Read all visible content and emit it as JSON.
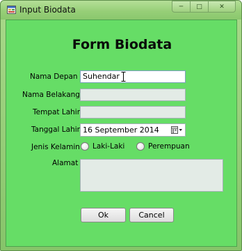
{
  "window": {
    "title": "Input Biodata",
    "controls": {
      "minimize": "─",
      "maximize": "□",
      "close": "✕"
    }
  },
  "form": {
    "heading": "Form Biodata",
    "fields": {
      "nama_depan": {
        "label": "Nama Depan",
        "value": "Suhendar"
      },
      "nama_belakang": {
        "label": "Nama Belakang",
        "value": ""
      },
      "tempat_lahir": {
        "label": "Tempat Lahir",
        "value": ""
      },
      "tanggal_lahir": {
        "label": "Tanggal Lahir",
        "value": "16 September 2014"
      },
      "jenis_kelamin": {
        "label": "Jenis Kelamin",
        "options": [
          "Laki-Laki",
          "Perempuan"
        ]
      },
      "alamat": {
        "label": "Alamat",
        "value": ""
      }
    },
    "buttons": {
      "ok": "Ok",
      "cancel": "Cancel"
    }
  },
  "colors": {
    "form_background": "#66dd66",
    "title_bar": "#97cf78",
    "input_background": "#e3ebe6"
  }
}
